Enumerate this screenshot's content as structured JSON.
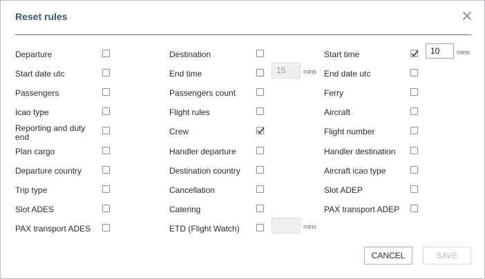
{
  "dialog": {
    "title": "Reset rules",
    "close_icon": "close-icon",
    "colors": {
      "title": "#3d5473",
      "divider": "#5a6b80",
      "accent": "#5a6b80"
    }
  },
  "rules": [
    {
      "id": "departure",
      "label": "Departure",
      "checked": false
    },
    {
      "id": "destination",
      "label": "Destination",
      "checked": false
    },
    {
      "id": "start-time",
      "label": "Start time",
      "checked": true,
      "value": "10",
      "unit": "mins",
      "editable": true
    },
    {
      "id": "start-date-utc",
      "label": "Start date utc",
      "checked": false
    },
    {
      "id": "end-time",
      "label": "End time",
      "checked": false,
      "value": "15",
      "unit": "mins",
      "editable": false
    },
    {
      "id": "end-date-utc",
      "label": "End date utc",
      "checked": false
    },
    {
      "id": "passengers",
      "label": "Passengers",
      "checked": false
    },
    {
      "id": "passengers-count",
      "label": "Passengers count",
      "checked": false
    },
    {
      "id": "ferry",
      "label": "Ferry",
      "checked": false
    },
    {
      "id": "icao-type",
      "label": "Icao type",
      "checked": false
    },
    {
      "id": "flight-rules",
      "label": "Flight rules",
      "checked": false
    },
    {
      "id": "aircraft",
      "label": "Aircraft",
      "checked": false
    },
    {
      "id": "reporting-duty-end",
      "label": "Reporting and duty end",
      "label_line1": "Reporting and duty",
      "label_line2": "end",
      "checked": false
    },
    {
      "id": "crew",
      "label": "Crew",
      "checked": true
    },
    {
      "id": "flight-number",
      "label": "Flight number",
      "checked": false
    },
    {
      "id": "plan-cargo",
      "label": "Plan cargo",
      "checked": false
    },
    {
      "id": "handler-departure",
      "label": "Handler departure",
      "checked": false
    },
    {
      "id": "handler-destination",
      "label": "Handler destination",
      "checked": false
    },
    {
      "id": "departure-country",
      "label": "Departure country",
      "checked": false
    },
    {
      "id": "destination-country",
      "label": "Destination country",
      "checked": false
    },
    {
      "id": "aircraft-icao-type",
      "label": "Aircraft icao type",
      "checked": false
    },
    {
      "id": "trip-type",
      "label": "Trip type",
      "checked": false
    },
    {
      "id": "cancellation",
      "label": "Cancellation",
      "checked": false
    },
    {
      "id": "slot-adep",
      "label": "Slot ADEP",
      "checked": false
    },
    {
      "id": "slot-ades",
      "label": "Slot ADES",
      "checked": false
    },
    {
      "id": "catering",
      "label": "Catering",
      "checked": false
    },
    {
      "id": "pax-transport-adep",
      "label": "PAX transport ADEP",
      "checked": false
    },
    {
      "id": "pax-transport-ades",
      "label": "PAX transport ADES",
      "checked": false
    },
    {
      "id": "etd-flight-watch",
      "label": "ETD (Flight Watch)",
      "checked": false,
      "value": "",
      "unit": "mins",
      "editable": false
    }
  ],
  "footer": {
    "cancel_label": "CANCEL",
    "save_label": "SAVE",
    "save_enabled": false
  }
}
